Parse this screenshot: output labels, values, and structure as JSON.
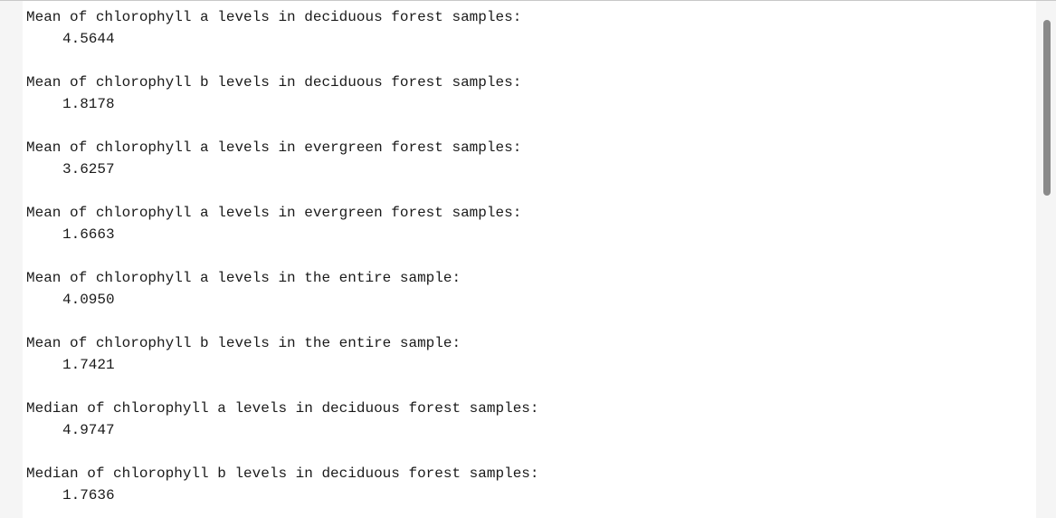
{
  "results": [
    {
      "label": "Mean of chlorophyll a levels in deciduous forest samples:",
      "value": "4.5644"
    },
    {
      "label": "Mean of chlorophyll b levels in deciduous forest samples:",
      "value": "1.8178"
    },
    {
      "label": "Mean of chlorophyll a levels in evergreen forest samples:",
      "value": "3.6257"
    },
    {
      "label": "Mean of chlorophyll a levels in evergreen forest samples:",
      "value": "1.6663"
    },
    {
      "label": "Mean of chlorophyll a levels in the entire sample:",
      "value": "4.0950"
    },
    {
      "label": "Mean of chlorophyll b levels in the entire sample:",
      "value": "1.7421"
    },
    {
      "label": "Median of chlorophyll a levels in deciduous forest samples:",
      "value": "4.9747"
    },
    {
      "label": "Median of chlorophyll b levels in deciduous forest samples:",
      "value": "1.7636"
    }
  ],
  "scrollbar": {
    "position_fraction": 0.0
  }
}
